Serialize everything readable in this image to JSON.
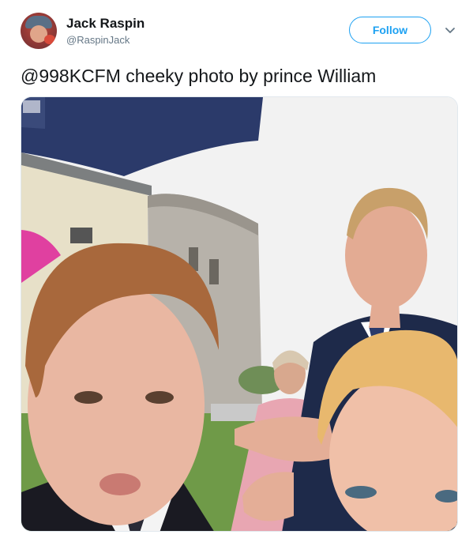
{
  "user": {
    "name": "Jack Raspin",
    "handle": "@RaspinJack",
    "avatar_icon": "user-avatar-icon"
  },
  "actions": {
    "follow_label": "Follow",
    "menu_icon": "chevron-down-icon"
  },
  "tweet": {
    "text": "@998KCFM cheeky photo by prince William"
  },
  "colors": {
    "accent": "#1da1f2",
    "text": "#14171a",
    "secondary_text": "#657786"
  }
}
